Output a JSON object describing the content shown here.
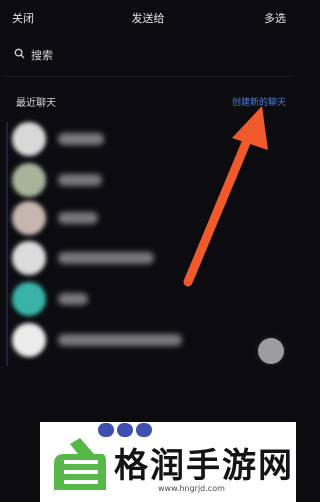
{
  "header": {
    "close_label": "关闭",
    "title": "发送给",
    "multi_select_label": "多选"
  },
  "search": {
    "label": "搜索"
  },
  "recent": {
    "section_title": "最近聊天",
    "create_new_chat_label": "创建新的聊天"
  },
  "contacts": [
    {
      "avatar_color": "#d8d8d8",
      "name_color": "#b9b9b9"
    },
    {
      "avatar_color": "#a7b39a",
      "name_color": "#b4b4b4"
    },
    {
      "avatar_color": "#c7b6b0",
      "name_color": "#b4b4b4"
    },
    {
      "avatar_color": "#dcdcdc",
      "name_color": "#b4b4b4"
    },
    {
      "avatar_color": "#39b3a7",
      "name_color": "#b4b4b4"
    },
    {
      "avatar_color": "#ececec",
      "name_color": "#b4b4b4"
    }
  ],
  "colors": {
    "background": "#0c0c10",
    "accent_link": "#4d7fd6",
    "arrow": "#f05a2b"
  },
  "watermark": {
    "text": "格润手游网",
    "url": "www.hngrjd.com"
  }
}
